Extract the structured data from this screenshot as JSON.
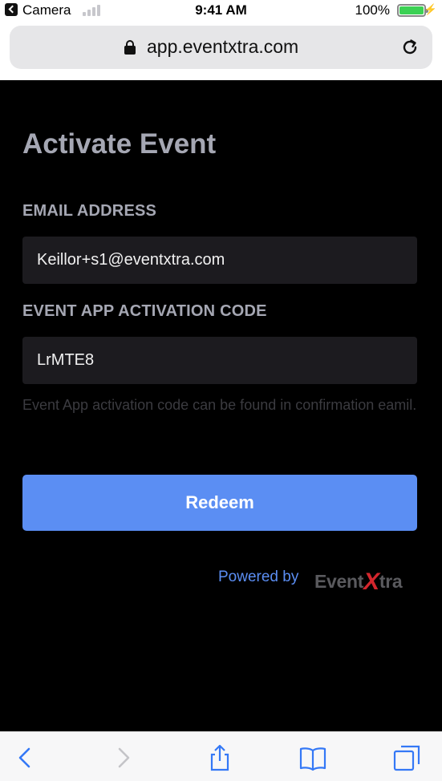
{
  "status_bar": {
    "app": "Camera",
    "time": "9:41 AM",
    "battery": "100%"
  },
  "browser": {
    "url": "app.eventxtra.com"
  },
  "page": {
    "title": "Activate Event",
    "email_label": "EMAIL ADDRESS",
    "email_value": "Keillor+s1@eventxtra.com",
    "code_label": "EVENT APP ACTIVATION CODE",
    "code_value": "LrMTE8",
    "help": "Event App activation code can be found in confirmation eamil.",
    "button": "Redeem",
    "powered_by": "Powered by",
    "brand_prefix": "Event",
    "brand_x": "X",
    "brand_suffix": "tra"
  },
  "colors": {
    "accent": "#5b8ef3",
    "background": "#000000",
    "field": "#1c1b1f",
    "brand_x": "#d3262d"
  },
  "icons": [
    "back-arrow-icon",
    "signal-icon",
    "battery-icon",
    "lock-icon",
    "reload-icon",
    "chevron-left-icon",
    "chevron-right-icon",
    "share-icon",
    "bookmarks-icon",
    "tabs-icon"
  ]
}
